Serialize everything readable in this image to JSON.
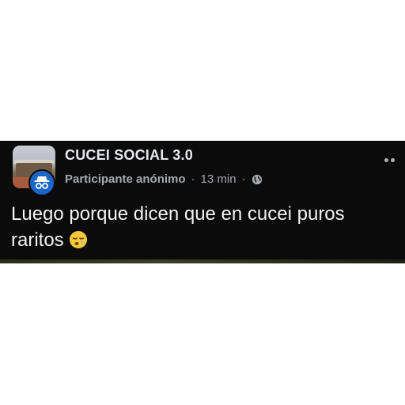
{
  "post": {
    "group_name": "CUCEI SOCIAL 3.0",
    "author": "Participante anónimo",
    "separator": "·",
    "time": "13 min",
    "visibility_icon": "globe-icon",
    "text": "Luego porque dicen que en cucei puros raritos",
    "emoji": "sleepy-face-emoji",
    "more_icon": "more-options-icon"
  },
  "colors": {
    "background": "#0b0b0c",
    "primary_text": "#e7e9ee",
    "secondary_text": "#a6a9b0",
    "anon_badge": "#1b67c9"
  }
}
